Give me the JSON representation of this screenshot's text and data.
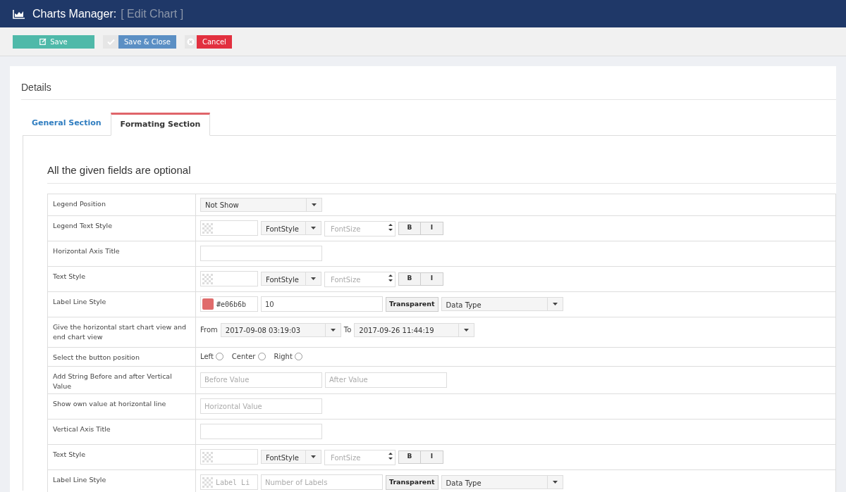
{
  "header": {
    "title": "Charts Manager:",
    "subtitle": "[ Edit Chart ]"
  },
  "toolbar": [
    {
      "kind": "save",
      "label": "Save"
    },
    {
      "kind": "save_close",
      "label": "Save & Close"
    },
    {
      "kind": "cancel",
      "label": "Cancel"
    }
  ],
  "panel_title": "Details",
  "tabs": [
    {
      "label": "General Section",
      "selected": false
    },
    {
      "label": "Formating Section",
      "selected": true
    }
  ],
  "section_heading": "All the given fields are optional",
  "rows": [
    {
      "label": "Legend Position",
      "kind": "select",
      "value": "Not Show"
    },
    {
      "label": "Legend Text Style",
      "kind": "text_style",
      "font_style": "FontStyle",
      "font_size_placeholder": "FontSize",
      "bold": "B",
      "italic": "I"
    },
    {
      "label": "Horizontal Axis Title",
      "kind": "input"
    },
    {
      "label": "Text Style",
      "kind": "text_style",
      "font_style": "FontStyle",
      "font_size_placeholder": "FontSize",
      "bold": "B",
      "italic": "I"
    },
    {
      "label": "Label Line Style",
      "kind": "line_style",
      "color": "#e06b6b",
      "color_value": "#e06b6b",
      "number_value": "10",
      "transparent": "Transparent",
      "data_type": "Data Type"
    },
    {
      "label": "Give the horizontal start chart view and end chart view",
      "kind": "date_range",
      "from_label": "From",
      "from_value": "2017-09-08 03:19:03",
      "to_label": "To",
      "to_value": "2017-09-26 11:44:19"
    },
    {
      "label": "Select the button position",
      "kind": "radios",
      "options": [
        {
          "label": "Left",
          "selected": false
        },
        {
          "label": "Center",
          "selected": false
        },
        {
          "label": "Right",
          "selected": false
        }
      ]
    },
    {
      "label": "Add String Before and after Vertical Value",
      "kind": "two_inputs",
      "placeholders": [
        "Before Value",
        "After Value"
      ]
    },
    {
      "label": "Show own value at horizontal line",
      "kind": "input",
      "placeholder": "Horizontal Value"
    },
    {
      "label": "Vertical Axis Title",
      "kind": "input"
    },
    {
      "label": "Text Style",
      "kind": "text_style",
      "font_style": "FontStyle",
      "font_size_placeholder": "FontSize",
      "bold": "B",
      "italic": "I"
    },
    {
      "label": "Label Line Style",
      "kind": "line_style",
      "color_placeholder": "Label Li",
      "number_placeholder": "Number of Labels",
      "transparent": "Transparent",
      "data_type": "Data Type"
    }
  ]
}
